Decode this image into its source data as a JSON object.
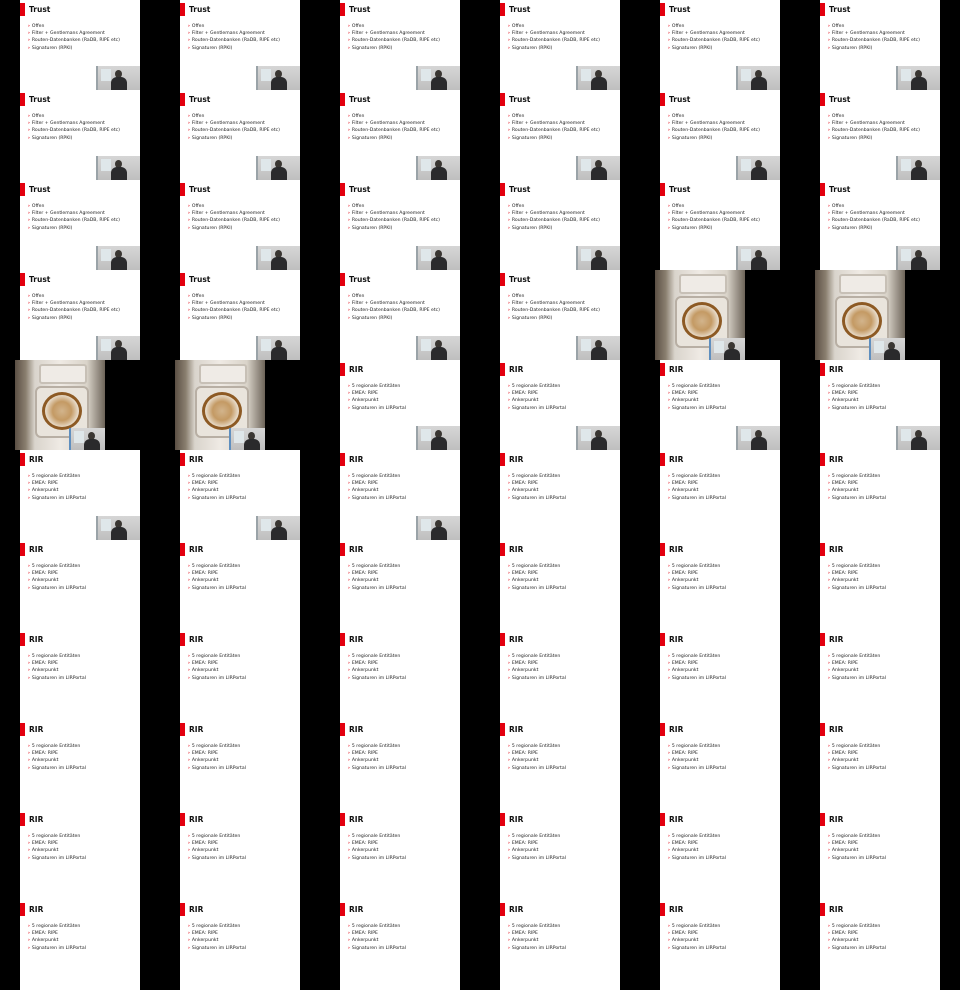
{
  "window": {
    "title": ""
  },
  "slides": {
    "trust": {
      "title": "Trust",
      "bullets": [
        "Offen",
        "Filter + Gentlemans Agreement",
        "Routen-Datenbanken (RaDB, RIPE etc)",
        "Signaturen (RPKI)"
      ]
    },
    "rir": {
      "title": "RIR",
      "bullets": [
        "5 regionale Entitäten",
        "EMEA: RIPE",
        "Ankerpunkt",
        "Signaturen im LIRPortal"
      ]
    }
  },
  "grid": {
    "columns": 6,
    "rows": 11,
    "cells": [
      "trust-cam",
      "trust-cam",
      "trust-cam",
      "trust-cam",
      "trust-cam",
      "trust-cam",
      "trust-cam",
      "trust-cam",
      "trust-cam",
      "trust-cam",
      "trust-cam",
      "trust-cam",
      "trust-cam",
      "trust-cam",
      "trust-cam",
      "trust-cam",
      "trust-cam",
      "trust-cam",
      "trust-cam",
      "trust-cam",
      "trust-cam",
      "trust-cam",
      "photo",
      "photo",
      "photo",
      "photo",
      "rir-cam",
      "rir-cam",
      "rir-cam",
      "rir-cam",
      "rir-cam",
      "rir-cam",
      "rir-cam",
      "rir",
      "rir",
      "rir",
      "rir",
      "rir",
      "rir",
      "rir",
      "rir",
      "rir",
      "rir",
      "rir",
      "rir",
      "rir",
      "rir",
      "rir",
      "rir",
      "rir",
      "rir",
      "rir",
      "rir",
      "rir",
      "rir",
      "rir",
      "rir",
      "rir",
      "rir",
      "rir",
      "rir",
      "rir",
      "rir",
      "rir",
      "rir",
      "rir"
    ]
  },
  "icons": {
    "accent_bar": "red-accent-bar-icon",
    "bullet": "chevron-right-icon",
    "webcam": "webcam-speaker-icon"
  },
  "colors": {
    "accent": "#e3000f",
    "background": "#000000",
    "slide": "#ffffff"
  }
}
